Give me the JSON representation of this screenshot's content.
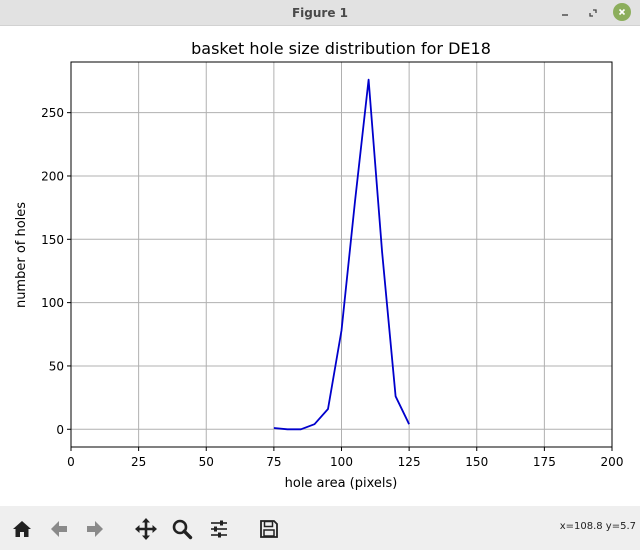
{
  "window": {
    "title": "Figure 1",
    "icons": [
      "minimize-icon",
      "maximize-icon",
      "close-icon"
    ]
  },
  "toolbar": {
    "icons": [
      "home-icon",
      "back-arrow-icon",
      "forward-arrow-icon",
      "pan-icon",
      "zoom-icon",
      "configure-subplots-icon",
      "save-icon"
    ],
    "coords": "x=108.8 y=5.7"
  },
  "colors": {
    "line": "#0000cc",
    "grid": "#b0b0b0",
    "close_button": "#8cae5c"
  },
  "chart_data": {
    "type": "line",
    "title": "basket hole size distribution for DE18",
    "xlabel": "hole area (pixels)",
    "ylabel": "number of holes",
    "xlim": [
      0,
      200
    ],
    "ylim": [
      -14,
      290
    ],
    "xticks": [
      0,
      25,
      50,
      75,
      100,
      125,
      150,
      175,
      200
    ],
    "yticks": [
      0,
      50,
      100,
      150,
      200,
      250
    ],
    "grid": true,
    "series": [
      {
        "x": [
          75,
          80,
          85,
          90,
          95,
          100,
          105,
          110,
          115,
          120,
          125
        ],
        "y": [
          1,
          0,
          0,
          4,
          16,
          78,
          180,
          276,
          140,
          26,
          4
        ]
      }
    ]
  }
}
